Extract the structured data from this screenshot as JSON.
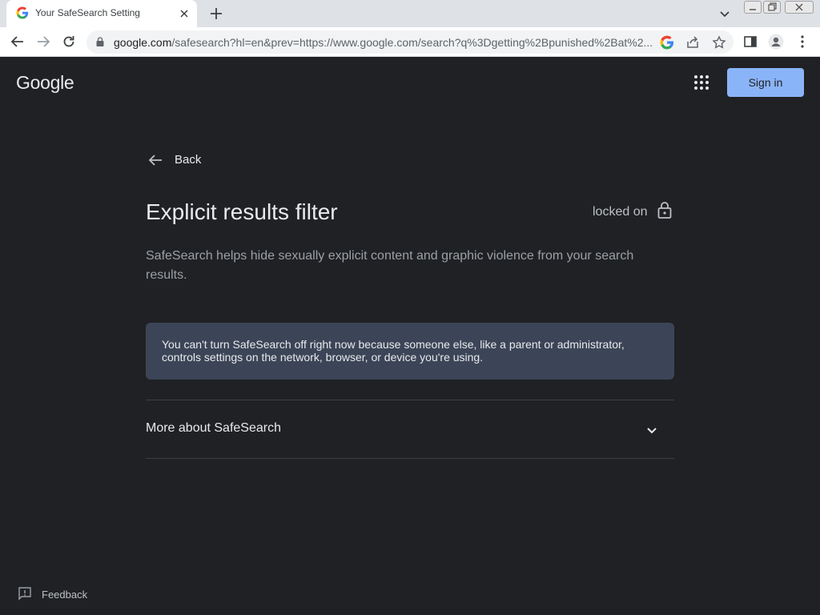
{
  "browser": {
    "tab_title": "Your SafeSearch Setting",
    "url_host": "google.com",
    "url_rest": "/safesearch?hl=en&prev=https://www.google.com/search?q%3Dgetting%2Bpunished%2Bat%2..."
  },
  "header": {
    "logo": "Google",
    "signin_label": "Sign in"
  },
  "main": {
    "back_label": "Back",
    "title": "Explicit results filter",
    "status_label": "locked on",
    "description": "SafeSearch helps hide sexually explicit content and graphic violence from your search results.",
    "notice": "You can't turn SafeSearch off right now because someone else, like a parent or administrator, controls settings on the network, browser, or device you're using.",
    "more_label": "More about SafeSearch"
  },
  "footer": {
    "feedback_label": "Feedback"
  },
  "colors": {
    "page_bg": "#202124",
    "accent": "#8ab4f8",
    "notice_bg": "#3c4557"
  }
}
